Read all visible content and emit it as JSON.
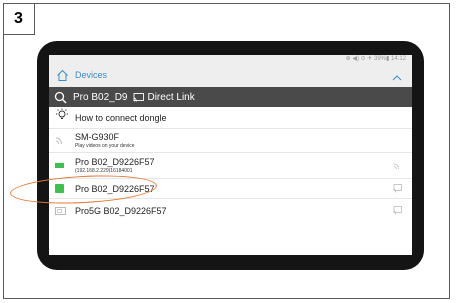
{
  "step_number": "3",
  "status_bar": {
    "text": "⊕ ◀) ⊙ ✈ 39%▮ 14:12"
  },
  "header": {
    "title": "Devices"
  },
  "search": {
    "term": "Pro B02_D9",
    "direct_link": "Direct Link"
  },
  "list": [
    {
      "name": "How to connect dongle",
      "subtitle": ""
    },
    {
      "name": "SM-G930F",
      "subtitle": "Play videos on your device"
    },
    {
      "name": "Pro B02_D9226F57",
      "subtitle": "(192.168.2.229)16184001"
    },
    {
      "name": "Pro B02_D9226F57",
      "subtitle": ""
    },
    {
      "name": "Pro5G B02_D9226F57",
      "subtitle": ""
    }
  ],
  "colors": {
    "accent": "#3b8ec9",
    "highlight": "#e07a3a",
    "device_green": "#3fbf4f"
  }
}
